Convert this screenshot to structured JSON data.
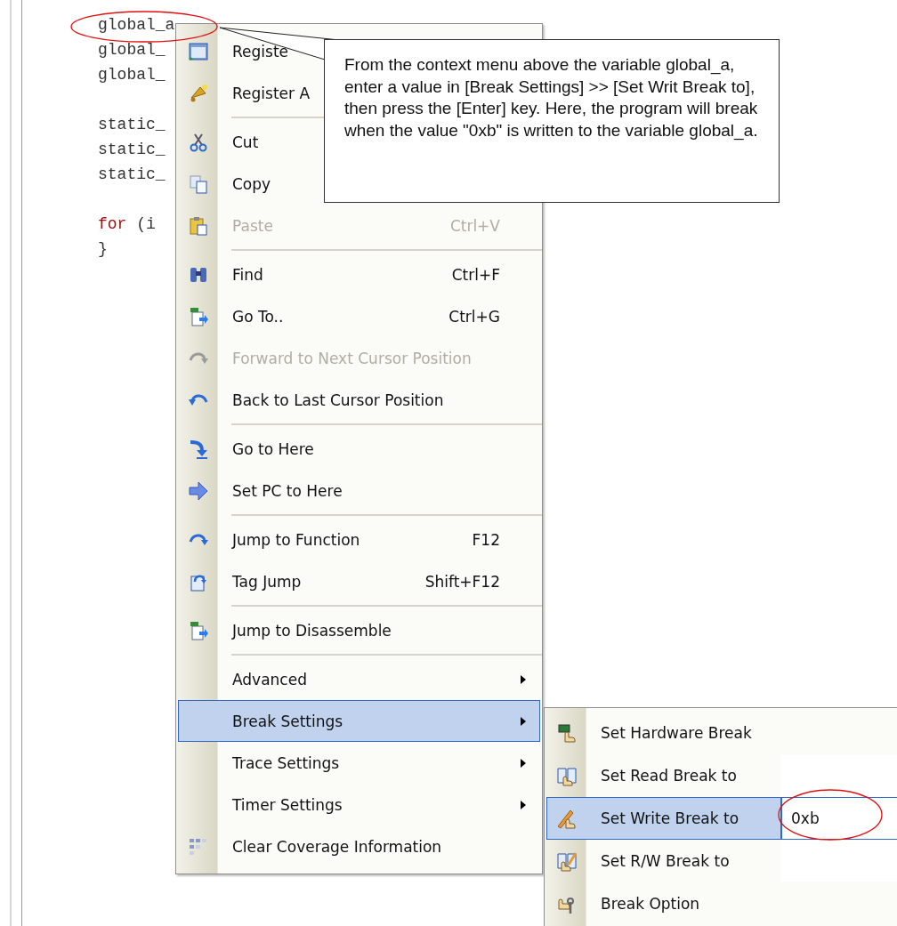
{
  "editor": {
    "lines": [
      {
        "kind": "code",
        "parts": [
          {
            "kind": "plain",
            "text": "global_a"
          }
        ]
      },
      {
        "kind": "code",
        "parts": [
          {
            "kind": "plain",
            "text": "global_"
          }
        ]
      },
      {
        "kind": "code",
        "parts": [
          {
            "kind": "plain",
            "text": "global_"
          }
        ]
      },
      {
        "kind": "blank"
      },
      {
        "kind": "code",
        "parts": [
          {
            "kind": "plain",
            "text": "static_"
          }
        ]
      },
      {
        "kind": "code",
        "parts": [
          {
            "kind": "plain",
            "text": "static_"
          }
        ]
      },
      {
        "kind": "code",
        "parts": [
          {
            "kind": "plain",
            "text": "static_"
          }
        ]
      },
      {
        "kind": "blank"
      },
      {
        "kind": "code",
        "parts": [
          {
            "kind": "keyword",
            "text": "for"
          },
          {
            "kind": "plain",
            "text": " (i"
          }
        ]
      },
      {
        "kind": "code",
        "parts": [
          {
            "kind": "plain",
            "text": "}"
          }
        ]
      }
    ]
  },
  "context_menu": {
    "items": [
      {
        "kind": "item",
        "label": "Registe",
        "disabled": false,
        "selected": false
      },
      {
        "kind": "item",
        "label": "Register A",
        "disabled": false,
        "selected": false
      },
      {
        "kind": "separator"
      },
      {
        "kind": "item",
        "label": "Cut",
        "disabled": false,
        "selected": false
      },
      {
        "kind": "item",
        "label": "Copy",
        "disabled": false,
        "selected": false
      },
      {
        "kind": "item",
        "label": "Paste",
        "shortcut": "Ctrl+V",
        "disabled": true,
        "selected": false
      },
      {
        "kind": "separator"
      },
      {
        "kind": "item",
        "label": "Find",
        "shortcut": "Ctrl+F",
        "disabled": false,
        "selected": false
      },
      {
        "kind": "item",
        "label": "Go To..",
        "shortcut": "Ctrl+G",
        "disabled": false,
        "selected": false
      },
      {
        "kind": "item",
        "label": "Forward to Next Cursor Position",
        "disabled": true,
        "selected": false
      },
      {
        "kind": "item",
        "label": "Back to Last Cursor Position",
        "disabled": false,
        "selected": false
      },
      {
        "kind": "separator"
      },
      {
        "kind": "item",
        "label": "Go to Here",
        "disabled": false,
        "selected": false
      },
      {
        "kind": "item",
        "label": "Set PC to Here",
        "disabled": false,
        "selected": false
      },
      {
        "kind": "separator"
      },
      {
        "kind": "item",
        "label": "Jump to Function",
        "shortcut": "F12",
        "disabled": false,
        "selected": false
      },
      {
        "kind": "item",
        "label": "Tag Jump",
        "shortcut": "Shift+F12",
        "disabled": false,
        "selected": false
      },
      {
        "kind": "separator"
      },
      {
        "kind": "item",
        "label": "Jump to Disassemble",
        "disabled": false,
        "selected": false
      },
      {
        "kind": "separator"
      },
      {
        "kind": "submenu",
        "label": "Advanced",
        "disabled": false,
        "selected": false
      },
      {
        "kind": "submenu",
        "label": "Break Settings",
        "disabled": false,
        "selected": true
      },
      {
        "kind": "submenu",
        "label": "Trace Settings",
        "disabled": false,
        "selected": false
      },
      {
        "kind": "submenu",
        "label": "Timer Settings",
        "disabled": false,
        "selected": false
      },
      {
        "kind": "item",
        "label": "Clear Coverage Information",
        "disabled": false,
        "selected": false
      }
    ]
  },
  "submenu": {
    "items": [
      {
        "kind": "item",
        "label": "Set Hardware Break",
        "selected": false
      },
      {
        "kind": "input",
        "label": "Set Read Break to",
        "selected": false
      },
      {
        "kind": "input",
        "label": "Set Write Break to",
        "value": "0xb",
        "selected": true
      },
      {
        "kind": "input",
        "label": "Set R/W Break to",
        "selected": false
      },
      {
        "kind": "item",
        "label": "Break Option",
        "selected": false
      }
    ]
  },
  "callout": {
    "text": "From the context menu above the variable global_a, enter a value in [Break Settings] >> [Set Writ Break to], then press the [Enter] key. Here, the program will break when the value \"0xb\" is written to the variable global_a."
  }
}
